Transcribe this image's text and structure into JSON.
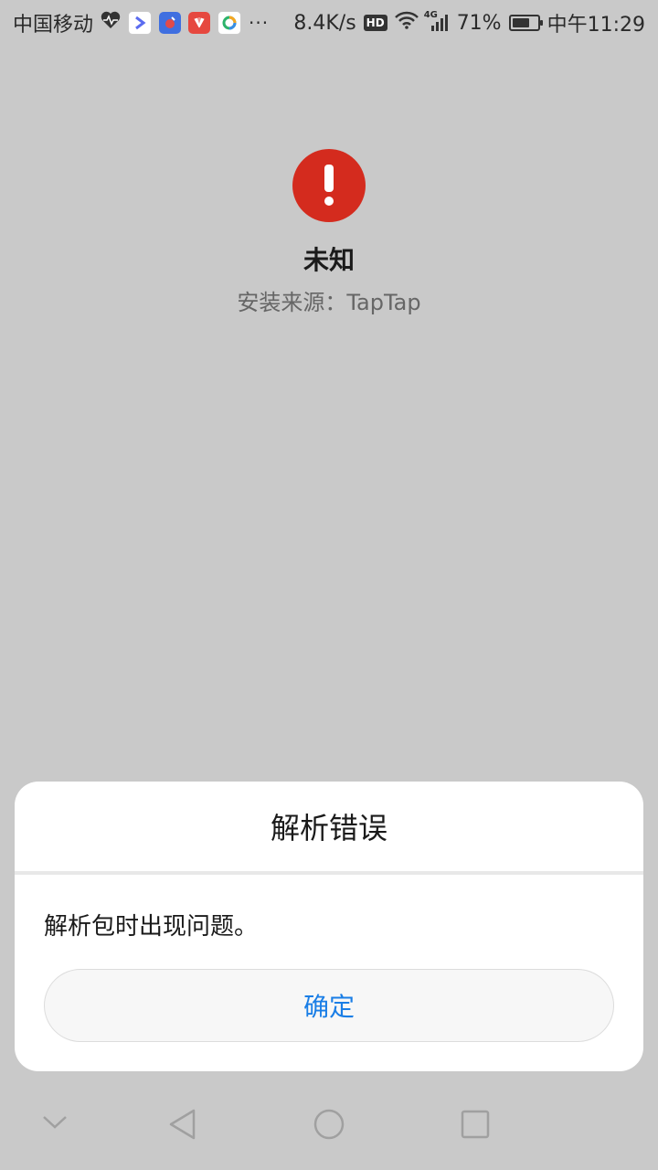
{
  "status_bar": {
    "carrier": "中国移动",
    "more": "···",
    "speed": "8.4K/s",
    "hd": "HD",
    "network": "4G",
    "battery": "71%",
    "battery_level": 0.71,
    "time": "中午11:29"
  },
  "app": {
    "name": "未知",
    "install_source": "安装来源：TapTap",
    "alert_color": "#d42b1e"
  },
  "dialog": {
    "title": "解析错误",
    "message": "解析包时出现问题。",
    "ok_label": "确定",
    "accent_color": "#1a7ee6"
  },
  "nav_bar": {
    "icons": [
      "chevron-down-icon",
      "back-icon",
      "home-icon",
      "recents-icon"
    ]
  }
}
